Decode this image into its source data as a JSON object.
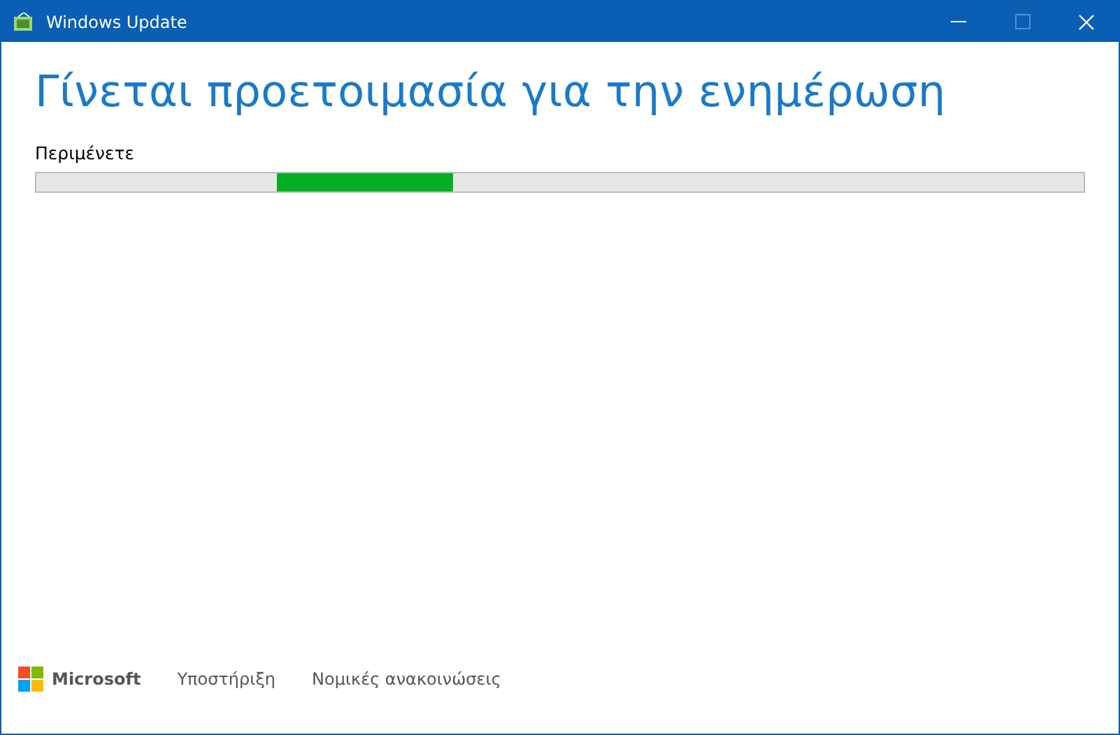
{
  "window": {
    "title": "Windows Update",
    "controls": [
      {
        "kind": "minimize",
        "disabled": false
      },
      {
        "kind": "maximize",
        "disabled": true
      },
      {
        "kind": "close",
        "disabled": false
      }
    ]
  },
  "heading": "Γίνεται προετοιμασία για την ενημέρωση",
  "status": "Περιμένετε",
  "progress": {
    "indeterminate": true
  },
  "footer": {
    "brand": "Microsoft",
    "links": [
      "Υποστήριξη",
      "Νομικές ανακοινώσεις"
    ]
  }
}
